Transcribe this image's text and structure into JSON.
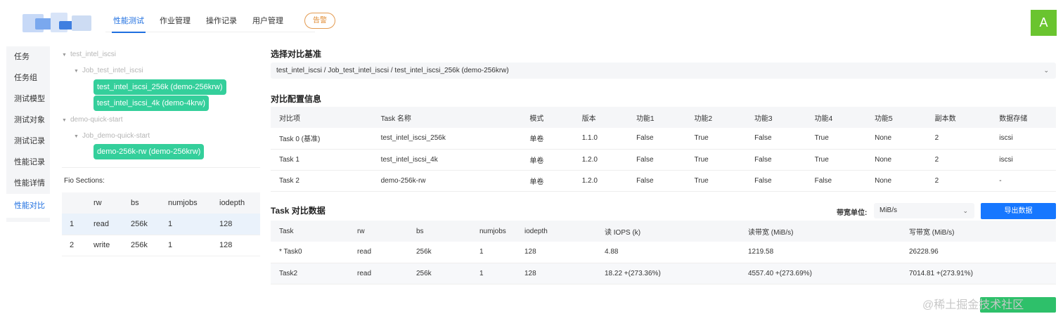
{
  "header": {
    "tabs": [
      {
        "label": "性能测试",
        "active": true
      },
      {
        "label": "作业管理",
        "active": false
      },
      {
        "label": "操作记录",
        "active": false
      },
      {
        "label": "用户管理",
        "active": false
      }
    ],
    "alert_label": "告警",
    "avatar_letter": "A",
    "colors": {
      "accent": "#1f6fe0",
      "alert": "#e08a30",
      "avatar": "#6ac42f",
      "tree_pill": "#34cf9b",
      "primary_button": "#1677ff"
    }
  },
  "sidebar": {
    "items": [
      {
        "label": "任务"
      },
      {
        "label": "任务组"
      },
      {
        "label": "测试模型"
      },
      {
        "label": "测试对象"
      },
      {
        "label": "测试记录"
      },
      {
        "label": "性能记录"
      },
      {
        "label": "性能详情"
      },
      {
        "label": "性能对比",
        "active": true
      }
    ]
  },
  "tree": {
    "group1": "test_intel_iscsi",
    "job1": "Job_test_intel_iscsi",
    "pill1": "test_intel_iscsi_256k (demo-256krw)",
    "pill2": "test_intel_iscsi_4k (demo-4krw)",
    "group2": "demo-quick-start",
    "job2": "Job_demo-quick-start",
    "pill3": "demo-256k-rw (demo-256krw)"
  },
  "fio": {
    "title": "Fio Sections:",
    "headers": [
      "",
      "rw",
      "bs",
      "numjobs",
      "iodepth"
    ],
    "rows": [
      [
        "1",
        "read",
        "256k",
        "1",
        "128"
      ],
      [
        "2",
        "write",
        "256k",
        "1",
        "128"
      ]
    ]
  },
  "baseline": {
    "title": "选择对比基准",
    "value": "test_intel_iscsi / Job_test_intel_iscsi / test_intel_iscsi_256k (demo-256krw)"
  },
  "config": {
    "title": "对比配置信息",
    "headers": [
      "对比项",
      "Task 名称",
      "模式",
      "版本",
      "功能1",
      "功能2",
      "功能3",
      "功能4",
      "功能5",
      "副本数",
      "数据存储"
    ],
    "rows": [
      [
        "Task 0 (基准)",
        "test_intel_iscsi_256k",
        "单卷",
        "1.1.0",
        "False",
        "True",
        "False",
        "True",
        "None",
        "2",
        "iscsi"
      ],
      [
        "Task 1",
        "test_intel_iscsi_4k",
        "单卷",
        "1.2.0",
        "False",
        "True",
        "False",
        "True",
        "None",
        "2",
        "iscsi"
      ],
      [
        "Task 2",
        "demo-256k-rw",
        "单卷",
        "1.2.0",
        "False",
        "True",
        "False",
        "False",
        "None",
        "2",
        "-"
      ]
    ]
  },
  "compare": {
    "title": "Task 对比数据",
    "unit_label": "带宽单位:",
    "unit_value": "MiB/s",
    "export_label": "导出数据",
    "headers": [
      "Task",
      "rw",
      "bs",
      "numjobs",
      "iodepth",
      "读 IOPS (k)",
      "读带宽 (MiB/s)",
      "写带宽 (MiB/s)"
    ],
    "rows": [
      [
        "* Task0",
        "read",
        "256k",
        "1",
        "128",
        "4.88",
        "1219.58",
        "26228.96"
      ],
      [
        "Task2",
        "read",
        "256k",
        "1",
        "128",
        "18.22 +(273.36%)",
        "4557.40 +(273.69%)",
        "7014.81 +(273.91%)"
      ]
    ]
  },
  "watermark": "@稀土掘金技术社区"
}
